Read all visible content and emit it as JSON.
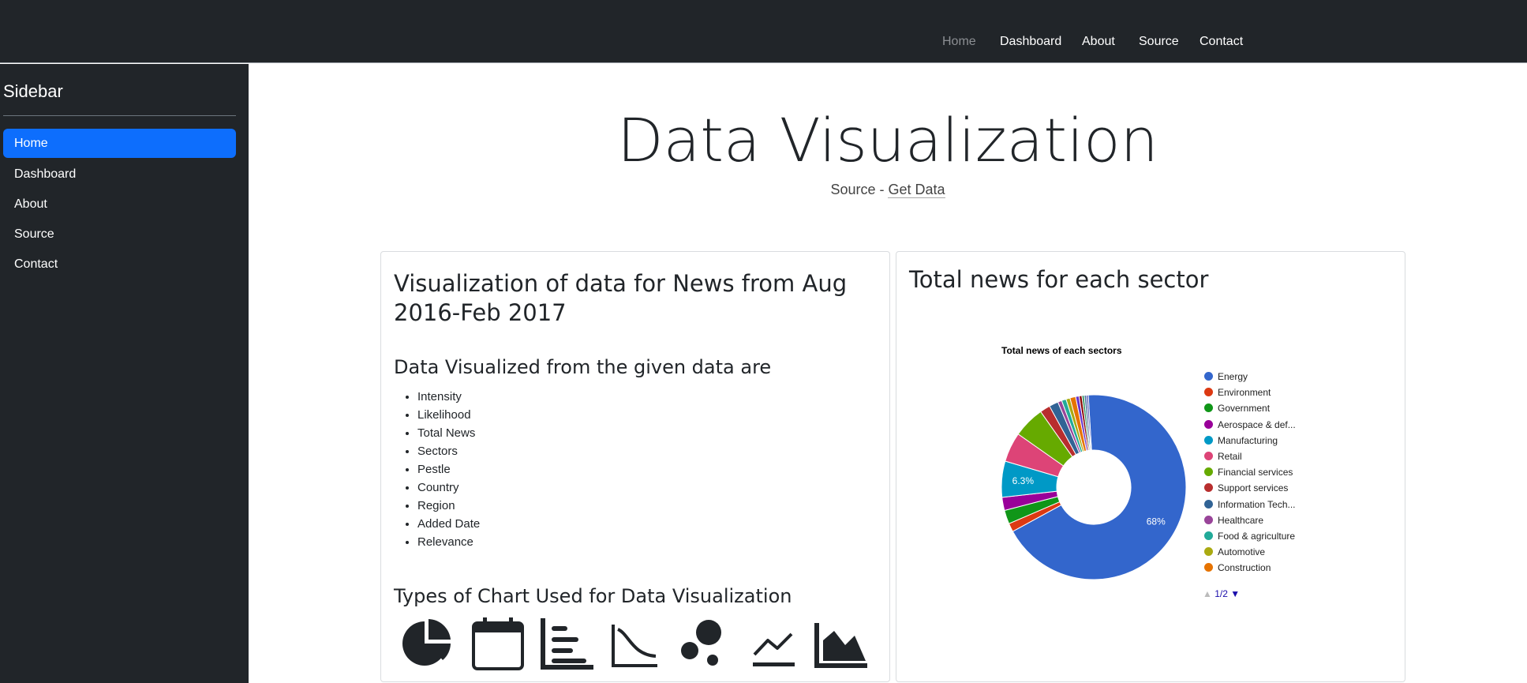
{
  "topnav": {
    "items": [
      {
        "label": "Home",
        "active": true
      },
      {
        "label": "Dashboard"
      },
      {
        "label": "About"
      },
      {
        "label": "Source"
      },
      {
        "label": "Contact"
      }
    ]
  },
  "sidebar": {
    "title": "Sidebar",
    "items": [
      {
        "label": "Home",
        "active": true
      },
      {
        "label": "Dashboard"
      },
      {
        "label": "About"
      },
      {
        "label": "Source"
      },
      {
        "label": "Contact"
      }
    ]
  },
  "hero": {
    "title": "Data Visualization",
    "source_prefix": "Source - ",
    "source_link": "Get Data"
  },
  "left_card": {
    "heading": "Visualization of data for News from Aug 2016-Feb 2017",
    "subheading": "Data Visualized from the given data are",
    "items": [
      "Intensity",
      "Likelihood",
      "Total News",
      "Sectors",
      "Pestle",
      "Country",
      "Region",
      "Added Date",
      "Relevance"
    ],
    "types_heading": "Types of Chart Used for Data Visualization",
    "chart_icons": [
      "pie-chart-icon",
      "calendar-icon",
      "bar-chart-icon",
      "curve-chart-icon",
      "bubble-chart-icon",
      "line-chart-icon",
      "area-chart-icon"
    ]
  },
  "right_card": {
    "heading": "Total news for each sector",
    "pager": "1/2"
  },
  "chart_data": {
    "type": "pie",
    "title": "Total news of each sectors",
    "legend_position": "right",
    "donut": true,
    "slices": [
      {
        "label": "Energy",
        "value": 68,
        "color": "#3366cc",
        "data_label": "68%"
      },
      {
        "label": "Environment",
        "value": 1.5,
        "color": "#dc3912"
      },
      {
        "label": "Government",
        "value": 2.4,
        "color": "#109618"
      },
      {
        "label": "Aerospace & def...",
        "value": 2.3,
        "color": "#990099"
      },
      {
        "label": "Manufacturing",
        "value": 6.3,
        "color": "#0099c6",
        "data_label": "6.3%"
      },
      {
        "label": "Retail",
        "value": 5.2,
        "color": "#dd4477"
      },
      {
        "label": "Financial services",
        "value": 5.5,
        "color": "#66aa00"
      },
      {
        "label": "Support services",
        "value": 1.8,
        "color": "#b82e2e"
      },
      {
        "label": "Information Tech...",
        "value": 1.6,
        "color": "#316395"
      },
      {
        "label": "Healthcare",
        "value": 0.7,
        "color": "#994499"
      },
      {
        "label": "Food & agriculture",
        "value": 0.8,
        "color": "#22aa99"
      },
      {
        "label": "Automotive",
        "value": 0.7,
        "color": "#aaaa11"
      },
      {
        "label": "Construction",
        "value": 1.0,
        "color": "#e67300"
      },
      {
        "label": "",
        "value": 0.6,
        "color": "#6633cc"
      },
      {
        "label": "",
        "value": 0.5,
        "color": "#8b0707"
      },
      {
        "label": "",
        "value": 0.4,
        "color": "#329262"
      },
      {
        "label": "",
        "value": 0.4,
        "color": "#5574a6"
      },
      {
        "label": "",
        "value": 0.3,
        "color": "#3b3eac"
      }
    ]
  }
}
